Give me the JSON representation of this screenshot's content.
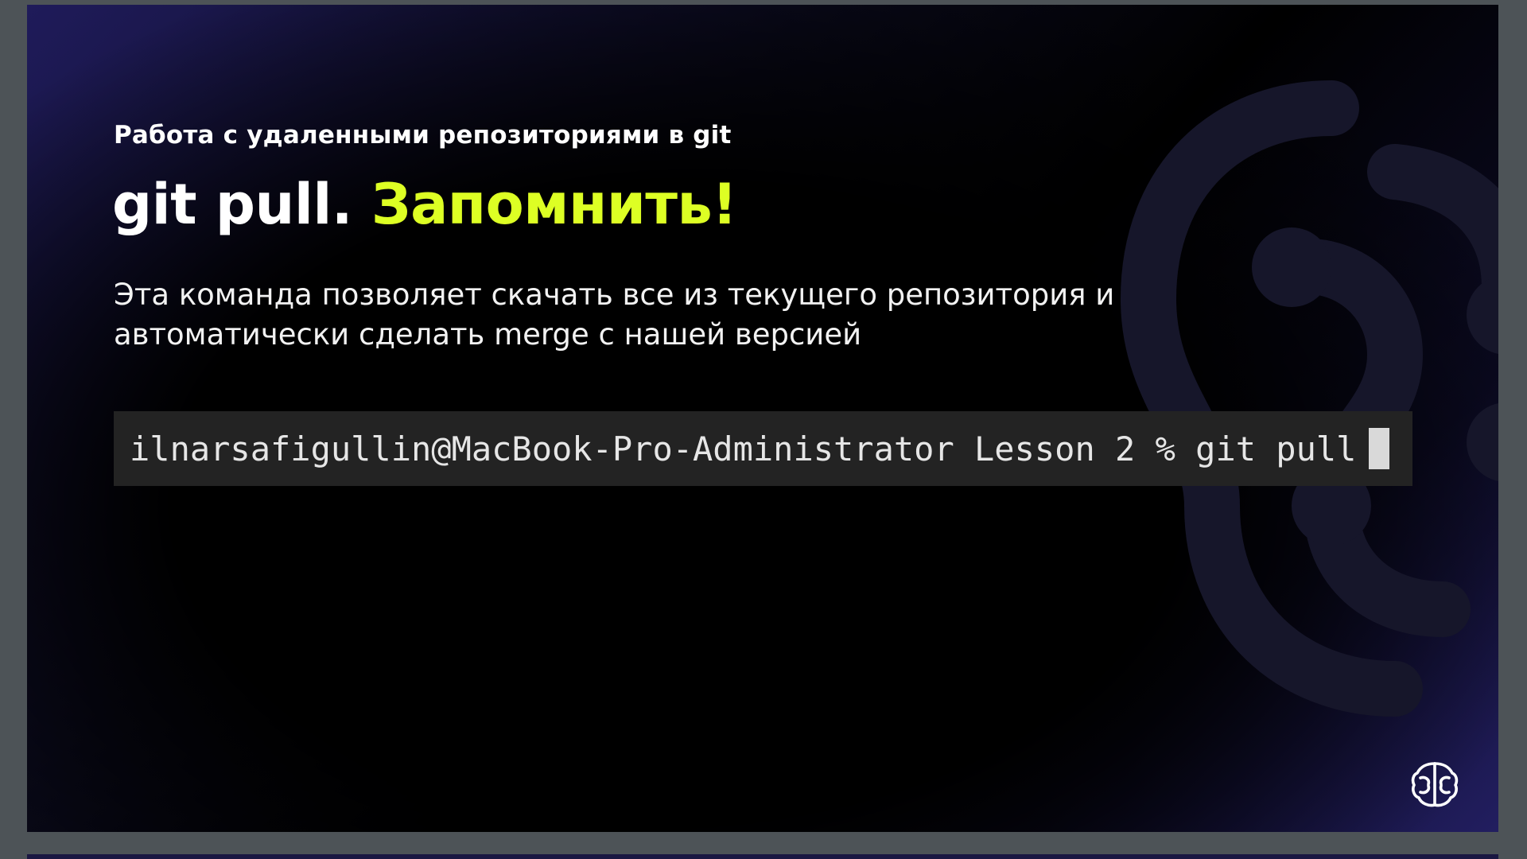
{
  "slide": {
    "subtitle": "Работа с удаленными репозиториями в git",
    "title_main": "git pull.",
    "title_accent": "Запомнить!",
    "body": "Эта команда позволяет скачать все из текущего репозитория и автоматически сделать merge с нашей версией",
    "terminal": {
      "prompt_line": "ilnarsafigullin@MacBook-Pro-Administrator Lesson 2 % git pull"
    },
    "logo_icon": "brain-logo-icon",
    "background_icon": "brain-watermark-icon"
  },
  "colors": {
    "accent": "#ddff24",
    "text": "#ffffff",
    "terminal_bg": "#232323",
    "viewer_bg": "#4d5357"
  }
}
